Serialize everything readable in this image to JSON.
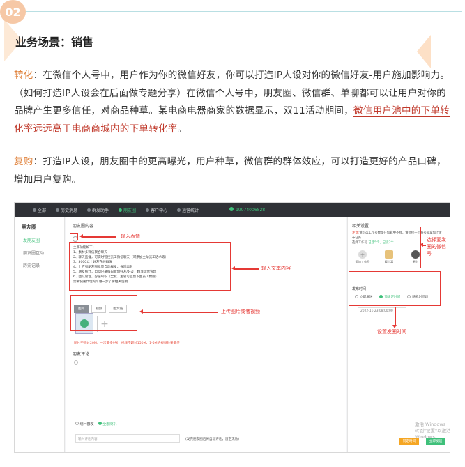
{
  "badge": "02",
  "title": "业务场景：销售",
  "para1": {
    "label": "转化",
    "text_a": "：在微信个人号中，用户作为你的微信好友，你可以打造IP人设对你的微信好友-用户施加影响力。（如何打造IP人设会在后面做专题分享）在微信个人号中，朋友圈、微信群、单聊都可以让用户对你的品牌产生更多信任，对商品种草。某电商电器商家的数据显示，双11活动期间，",
    "highlight": "微信用户池中的下单转化率远远高于电商商城内的下单转化率",
    "text_b": "。"
  },
  "para2": {
    "label": "复购",
    "text": "：打造IP人设，朋友圈中的更高曝光，用户种草，微信群的群体效应，可以打造更好的产品口碑，增加用户复购。"
  },
  "screenshot": {
    "topnav": [
      "全部",
      "历史消息",
      "群发助手",
      "朋友圈",
      "客户中心",
      "运营统计"
    ],
    "topnav_active": 3,
    "user": "19974006828",
    "sidebar": {
      "title": "朋友圈",
      "items": [
        "发朋友圈",
        "朋友圈互动",
        "历史记录"
      ],
      "active": 0
    },
    "crumb": "朋友圈内容",
    "text_lines": [
      "主要功能如下：",
      "1、素材多微信聚合聊天",
      "2、聊天监督，可实时管控员工微信聊天（可添加主动员工话术等）",
      "3、3000以上好友在线群发",
      "4、上百号朋友圈批量自动群发，省时高效",
      "5、朋友统计，自动记录每日新增好友/好友，精准运营管理",
      "6、团队管理，分层职权（全权、主管可监督下面员工数据）",
      "需要快速代理的可进一步了解相关说明"
    ],
    "media_tabs": [
      "图片",
      "视频",
      "图文链"
    ],
    "hint": "图片不超过20M，一次最多9张，视频不超过150M，1-5M的视频效果最佳",
    "comment_title": "朋友评论",
    "sync": {
      "label": "统一群发",
      "option": "全部随机"
    },
    "comment_placeholder": "输入评论内容",
    "comment_note": "(发完朋友圈后将自动评论，留空无效)",
    "right": {
      "title": "相关设置",
      "note_red": "注意:",
      "note_text": "请可选工作号数量在加载中不择，请选择一个账号或拿加上发布任务",
      "note_label": "选择工作号",
      "note_count": "已选5个，已读3个",
      "accounts": [
        "添加工作号",
        "暖小窝",
        "无为"
      ],
      "sched_title": "发布时间",
      "sched_options": [
        "立即发送",
        "预设定时间",
        "随机时间段"
      ],
      "sched_active": 1,
      "date": "2022-11-23 08:00:00",
      "btn_a": "同定时间",
      "btn_b": "立即发送",
      "watermark": [
        "激活 Windows",
        "转到\"设置\"以激活 Windows。"
      ]
    },
    "annotations": {
      "emoji": "输入表情",
      "text": "输入文本内容",
      "media": "上传图片或者视频",
      "account": "选择要发圈的微信号",
      "time": "设置发圈时间"
    }
  }
}
